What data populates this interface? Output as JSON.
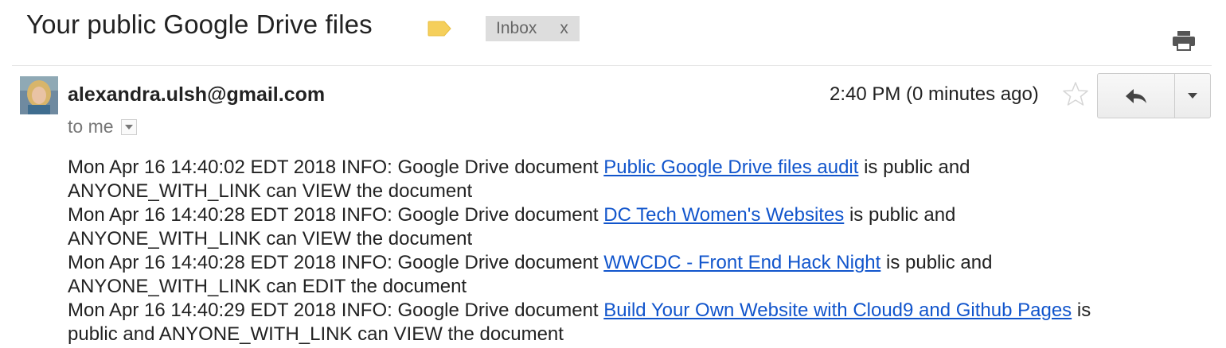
{
  "subject": "Your public Google Drive files",
  "label_tag_color": "#f5cf5b",
  "inbox_chip": {
    "label": "Inbox",
    "close": "x"
  },
  "sender": "alexandra.ulsh@gmail.com",
  "recipient": "to me",
  "timestamp": "2:40 PM (0 minutes ago)",
  "link_color": "#1155cc",
  "log_entries": [
    {
      "prefix": "Mon Apr 16 14:40:02 EDT 2018 INFO: Google Drive document ",
      "link": "Public Google Drive files audit",
      "suffix_line1": " is public and",
      "suffix_line2": "ANYONE_WITH_LINK can VIEW the document"
    },
    {
      "prefix": "Mon Apr 16 14:40:28 EDT 2018 INFO: Google Drive document ",
      "link": "DC Tech Women's Websites",
      "suffix_line1": " is public and",
      "suffix_line2": "ANYONE_WITH_LINK can VIEW the document"
    },
    {
      "prefix": "Mon Apr 16 14:40:28 EDT 2018 INFO: Google Drive document ",
      "link": "WWCDC - Front End Hack Night",
      "suffix_line1": " is public and",
      "suffix_line2": "ANYONE_WITH_LINK can EDIT the document"
    },
    {
      "prefix": "Mon Apr 16 14:40:29 EDT 2018 INFO: Google Drive document ",
      "link": "Build Your Own Website with Cloud9 and Github Pages",
      "suffix_line1": " is",
      "suffix_line2": "public and ANYONE_WITH_LINK can VIEW the document"
    }
  ]
}
